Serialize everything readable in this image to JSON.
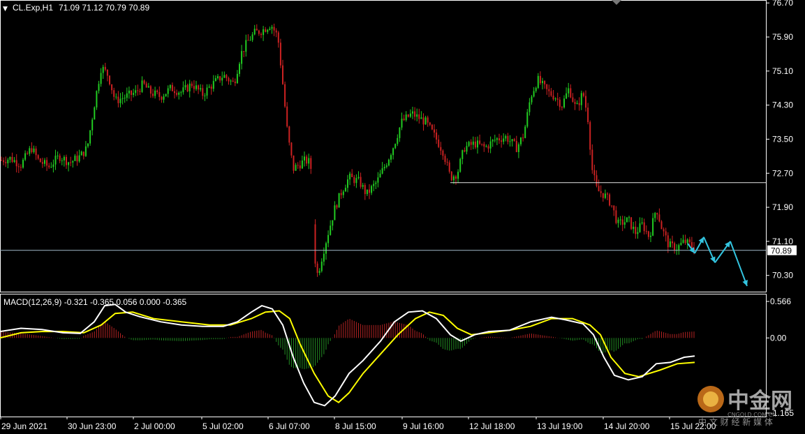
{
  "header": {
    "symbol_timeframe": "CL.Exp,H1",
    "ohlc": "71.09 71.12 70.79 70.89",
    "arrow": "▼"
  },
  "macd_header": {
    "label": "MACD(12,26,9) -0.321 -0.365 0.056 0.000 -0.365"
  },
  "watermark": {
    "brand": "中金网",
    "domain": "CNGOLD.COM.CN",
    "slogan": "中 文 财 经 新 媒 体"
  },
  "colors": {
    "background": "#000000",
    "bull": "#22cc22",
    "bear": "#cc2222",
    "macd_main": "#ffffff",
    "macd_signal": "#ffff00",
    "hist_pos": "#b22222",
    "hist_neg": "#228b22",
    "projection": "#33c5e0",
    "level_line": "#e6e6e6",
    "axis": "#ffffff"
  },
  "chart_data": [
    {
      "type": "candlestick",
      "title": "CL.Exp,H1",
      "ylim": [
        70.0,
        76.72
      ],
      "y_ticks": [
        "76.70",
        "75.90",
        "75.10",
        "74.30",
        "73.50",
        "72.70",
        "71.90",
        "71.10",
        "70.30"
      ],
      "x_ticks": [
        "29 Jun 2021",
        "30 Jun 23:00",
        "2 Jul 00:00",
        "5 Jul 02:00",
        "6 Jul 07:00",
        "8 Jul 15:00",
        "9 Jul 16:00",
        "12 Jul 18:00",
        "13 Jul 19:00",
        "14 Jul 20:00",
        "15 Jul 22:00"
      ],
      "current_price": "70.89",
      "current_price_value": 70.89,
      "support_line": 72.48,
      "close_path": [
        [
          0,
          73.0
        ],
        [
          15,
          73.05
        ],
        [
          30,
          72.9
        ],
        [
          45,
          73.3
        ],
        [
          55,
          73.0
        ],
        [
          70,
          72.85
        ],
        [
          85,
          73.1
        ],
        [
          100,
          72.95
        ],
        [
          115,
          73.1
        ],
        [
          125,
          73.3
        ],
        [
          135,
          74.3
        ],
        [
          145,
          75.2
        ],
        [
          155,
          75.0
        ],
        [
          165,
          74.4
        ],
        [
          180,
          74.5
        ],
        [
          195,
          74.6
        ],
        [
          205,
          74.8
        ],
        [
          215,
          74.6
        ],
        [
          230,
          74.5
        ],
        [
          245,
          74.7
        ],
        [
          260,
          74.6
        ],
        [
          275,
          74.8
        ],
        [
          290,
          74.55
        ],
        [
          305,
          74.8
        ],
        [
          320,
          75.0
        ],
        [
          335,
          74.8
        ],
        [
          345,
          75.5
        ],
        [
          355,
          75.8
        ],
        [
          365,
          76.0
        ],
        [
          375,
          76.05
        ],
        [
          388,
          76.2
        ],
        [
          398,
          75.9
        ],
        [
          405,
          74.8
        ],
        [
          412,
          73.6
        ],
        [
          420,
          72.8
        ],
        [
          428,
          72.9
        ],
        [
          437,
          73.0
        ],
        [
          445,
          72.95
        ],
        [
          450,
          70.8
        ],
        [
          455,
          70.3
        ],
        [
          462,
          70.8
        ],
        [
          470,
          71.3
        ],
        [
          480,
          71.9
        ],
        [
          490,
          72.3
        ],
        [
          500,
          72.6
        ],
        [
          515,
          72.5
        ],
        [
          525,
          72.2
        ],
        [
          540,
          72.5
        ],
        [
          555,
          73.0
        ],
        [
          565,
          73.4
        ],
        [
          575,
          73.9
        ],
        [
          590,
          74.1
        ],
        [
          600,
          74.0
        ],
        [
          610,
          73.9
        ],
        [
          625,
          73.5
        ],
        [
          635,
          73.2
        ],
        [
          645,
          72.6
        ],
        [
          655,
          72.7
        ],
        [
          665,
          73.3
        ],
        [
          680,
          73.4
        ],
        [
          695,
          73.3
        ],
        [
          710,
          73.5
        ],
        [
          725,
          73.55
        ],
        [
          740,
          73.3
        ],
        [
          750,
          73.6
        ],
        [
          760,
          74.5
        ],
        [
          770,
          74.9
        ],
        [
          785,
          74.6
        ],
        [
          795,
          74.5
        ],
        [
          805,
          74.3
        ],
        [
          815,
          74.7
        ],
        [
          825,
          74.2
        ],
        [
          835,
          74.6
        ],
        [
          842,
          74.0
        ],
        [
          848,
          72.8
        ],
        [
          855,
          72.3
        ],
        [
          865,
          72.2
        ],
        [
          875,
          72.0
        ],
        [
          885,
          71.5
        ],
        [
          900,
          71.6
        ],
        [
          910,
          71.3
        ],
        [
          920,
          71.5
        ],
        [
          930,
          71.2
        ],
        [
          940,
          71.9
        ],
        [
          948,
          71.4
        ],
        [
          958,
          71.0
        ],
        [
          970,
          70.95
        ],
        [
          980,
          71.1
        ],
        [
          990,
          71.0
        ],
        [
          995,
          70.89
        ]
      ],
      "projection": [
        [
          985,
          71.05
        ],
        [
          995,
          70.82
        ],
        [
          1008,
          71.2
        ],
        [
          1024,
          70.6
        ],
        [
          1046,
          71.1
        ],
        [
          1070,
          70.05
        ]
      ]
    },
    {
      "type": "line",
      "title": "MACD(12,26,9)",
      "ylim": [
        -1.165,
        0.566
      ],
      "y_ticks": [
        "0.566",
        "0.00",
        "-1.165"
      ],
      "series": [
        {
          "name": "MACD",
          "values": [
            [
              0,
              0.1
            ],
            [
              30,
              0.15
            ],
            [
              60,
              0.13
            ],
            [
              90,
              0.08
            ],
            [
              115,
              0.07
            ],
            [
              135,
              0.25
            ],
            [
              150,
              0.5
            ],
            [
              165,
              0.52
            ],
            [
              180,
              0.4
            ],
            [
              200,
              0.33
            ],
            [
              230,
              0.25
            ],
            [
              260,
              0.2
            ],
            [
              290,
              0.18
            ],
            [
              320,
              0.18
            ],
            [
              340,
              0.25
            ],
            [
              360,
              0.4
            ],
            [
              375,
              0.5
            ],
            [
              390,
              0.45
            ],
            [
              405,
              0.2
            ],
            [
              420,
              -0.3
            ],
            [
              435,
              -0.7
            ],
            [
              450,
              -1.0
            ],
            [
              465,
              -1.05
            ],
            [
              480,
              -0.9
            ],
            [
              500,
              -0.55
            ],
            [
              520,
              -0.35
            ],
            [
              545,
              -0.05
            ],
            [
              565,
              0.25
            ],
            [
              585,
              0.4
            ],
            [
              605,
              0.42
            ],
            [
              625,
              0.3
            ],
            [
              645,
              0.05
            ],
            [
              660,
              -0.05
            ],
            [
              680,
              0.05
            ],
            [
              700,
              0.1
            ],
            [
              730,
              0.12
            ],
            [
              760,
              0.25
            ],
            [
              790,
              0.32
            ],
            [
              810,
              0.28
            ],
            [
              835,
              0.22
            ],
            [
              850,
              0.05
            ],
            [
              865,
              -0.3
            ],
            [
              880,
              -0.58
            ],
            [
              900,
              -0.65
            ],
            [
              920,
              -0.6
            ],
            [
              940,
              -0.4
            ],
            [
              960,
              -0.38
            ],
            [
              980,
              -0.3
            ],
            [
              995,
              -0.28
            ]
          ]
        },
        {
          "name": "Signal",
          "values": [
            [
              0,
              0.0
            ],
            [
              30,
              0.08
            ],
            [
              60,
              0.1
            ],
            [
              90,
              0.1
            ],
            [
              120,
              0.08
            ],
            [
              145,
              0.2
            ],
            [
              165,
              0.38
            ],
            [
              190,
              0.4
            ],
            [
              220,
              0.3
            ],
            [
              260,
              0.25
            ],
            [
              300,
              0.2
            ],
            [
              330,
              0.2
            ],
            [
              360,
              0.3
            ],
            [
              380,
              0.4
            ],
            [
              400,
              0.42
            ],
            [
              415,
              0.3
            ],
            [
              430,
              -0.1
            ],
            [
              450,
              -0.55
            ],
            [
              470,
              -0.9
            ],
            [
              485,
              -1.0
            ],
            [
              500,
              -0.85
            ],
            [
              520,
              -0.55
            ],
            [
              545,
              -0.25
            ],
            [
              570,
              0.05
            ],
            [
              595,
              0.3
            ],
            [
              615,
              0.4
            ],
            [
              635,
              0.35
            ],
            [
              655,
              0.15
            ],
            [
              675,
              0.05
            ],
            [
              700,
              0.08
            ],
            [
              730,
              0.12
            ],
            [
              760,
              0.18
            ],
            [
              790,
              0.3
            ],
            [
              820,
              0.3
            ],
            [
              845,
              0.2
            ],
            [
              860,
              0.05
            ],
            [
              875,
              -0.3
            ],
            [
              895,
              -0.55
            ],
            [
              915,
              -0.6
            ],
            [
              945,
              -0.5
            ],
            [
              970,
              -0.4
            ],
            [
              995,
              -0.38
            ]
          ]
        }
      ]
    }
  ]
}
